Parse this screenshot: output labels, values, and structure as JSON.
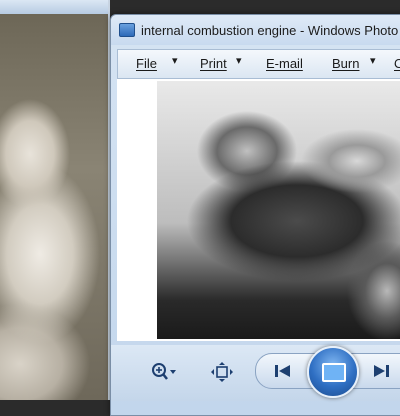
{
  "window": {
    "title": "internal combustion engine - Windows Photo V"
  },
  "menu": {
    "file": "File",
    "print": "Print",
    "email": "E-mail",
    "burn": "Burn",
    "partial": "O",
    "arrow": "▾"
  },
  "toolbar": {
    "zoom_icon": "zoom-icon",
    "fit_icon": "fit-to-window-icon",
    "prev_icon": "previous-icon",
    "slideshow_icon": "slideshow-icon",
    "next_icon": "next-icon"
  },
  "colors": {
    "accent": "#2f6fc3",
    "chrome": "#c8daef"
  }
}
